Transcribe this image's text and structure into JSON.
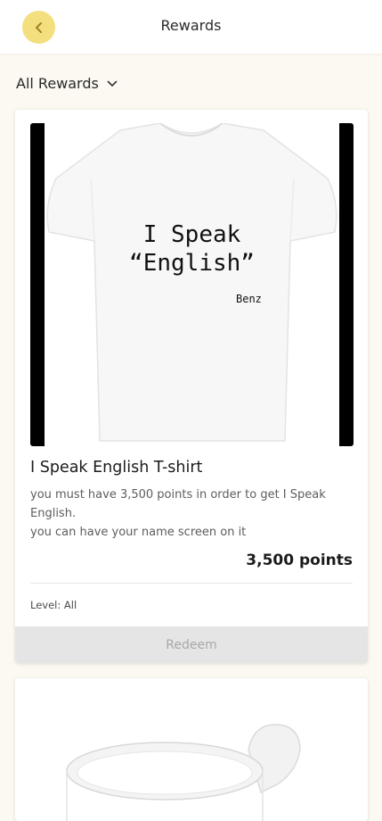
{
  "header": {
    "title": "Rewards",
    "back_icon": "chevron-left-icon",
    "accent_color": "#f3df7e"
  },
  "filter": {
    "label": "All Rewards",
    "icon": "chevron-down-icon"
  },
  "rewards": [
    {
      "image": {
        "line1": "I Speak",
        "line2": "“English”",
        "signature": "Benz"
      },
      "title": "I Speak English T-shirt",
      "description_line1": "you must have 3,500 points in order to get I Speak English.",
      "description_line2": "you can have your name screen on it",
      "points": "3,500 points",
      "level": "Level: All",
      "redeem_label": "Redeem"
    }
  ]
}
